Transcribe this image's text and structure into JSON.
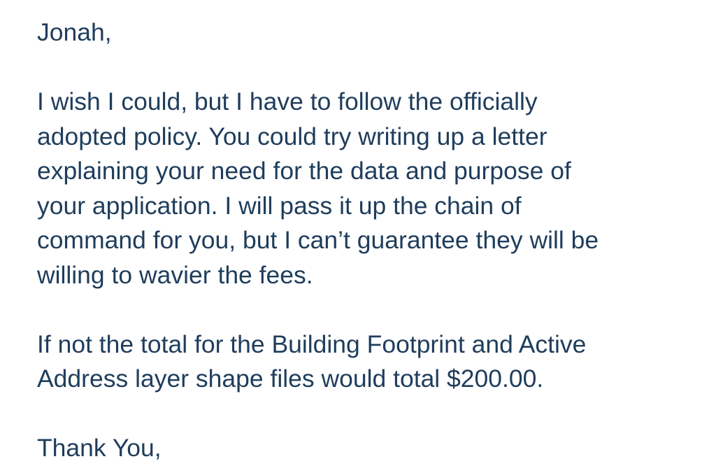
{
  "message": {
    "greeting": "Jonah,",
    "paragraph1": [
      "I wish I could, but I have to follow the officially",
      "adopted policy. You could try writing up a letter",
      "explaining your need for the data and purpose of",
      "your application. I will pass it up the chain of",
      "command for you, but I can’t guarantee they will be",
      "willing to wavier the fees."
    ],
    "paragraph2": [
      "If not the total for the Building Footprint and Active",
      "Address layer shape files would total $200.00."
    ],
    "closing": "Thank You,"
  },
  "colors": {
    "text": "#1f3d5c",
    "background": "#ffffff"
  }
}
